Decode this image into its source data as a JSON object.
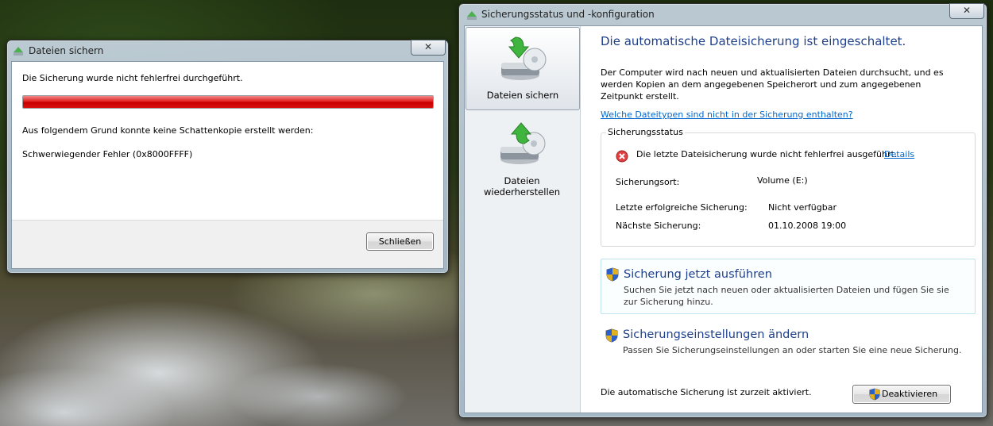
{
  "dialog": {
    "title": "Dateien sichern",
    "close_label": "✕",
    "message": "Die Sicherung wurde nicht fehlerfrei durchgeführt.",
    "progress_percent": 100,
    "progress_color": "#d00000",
    "reason": "Aus folgendem Grund konnte keine Schattenkopie erstellt werden:",
    "error": "Schwerwiegender Fehler (0x8000FFFF)",
    "close_button": "Schließen"
  },
  "main": {
    "title": "Sicherungsstatus und -konfiguration",
    "close_label": "✕",
    "sidebar": [
      {
        "label": "Dateien sichern",
        "icon": "backup-drive-icon"
      },
      {
        "label": "Dateien wiederherstellen",
        "icon": "restore-drive-icon"
      }
    ],
    "heading": "Die automatische Dateisicherung ist eingeschaltet.",
    "description": "Der Computer wird nach neuen und aktualisierten Dateien durchsucht, und es werden Kopien an dem angegebenen Speicherort und zum angegebenen Zeitpunkt erstellt.",
    "filetypes_link": "Welche Dateitypen sind nicht in der Sicherung enthalten?",
    "status": {
      "group_title": "Sicherungsstatus",
      "error_text": "Die letzte Dateisicherung wurde nicht fehlerfrei ausgeführt.",
      "details_link": "Details",
      "location_label": "Sicherungsort:",
      "location_value": "Volume (E:)",
      "last_label": "Letzte erfolgreiche Sicherung:",
      "last_value": "Nicht verfügbar",
      "next_label": "Nächste Sicherung:",
      "next_value": "01.10.2008 19:00"
    },
    "tasks": [
      {
        "title": "Sicherung jetzt ausführen",
        "desc": "Suchen Sie jetzt nach neuen oder aktualisierten Dateien und fügen Sie sie zur Sicherung hinzu."
      },
      {
        "title": "Sicherungseinstellungen ändern",
        "desc": "Passen Sie Sicherungseinstellungen an oder starten Sie eine neue Sicherung."
      }
    ],
    "footer_status": "Die automatische Sicherung ist zurzeit aktiviert.",
    "deactivate_button": "Deaktivieren"
  }
}
